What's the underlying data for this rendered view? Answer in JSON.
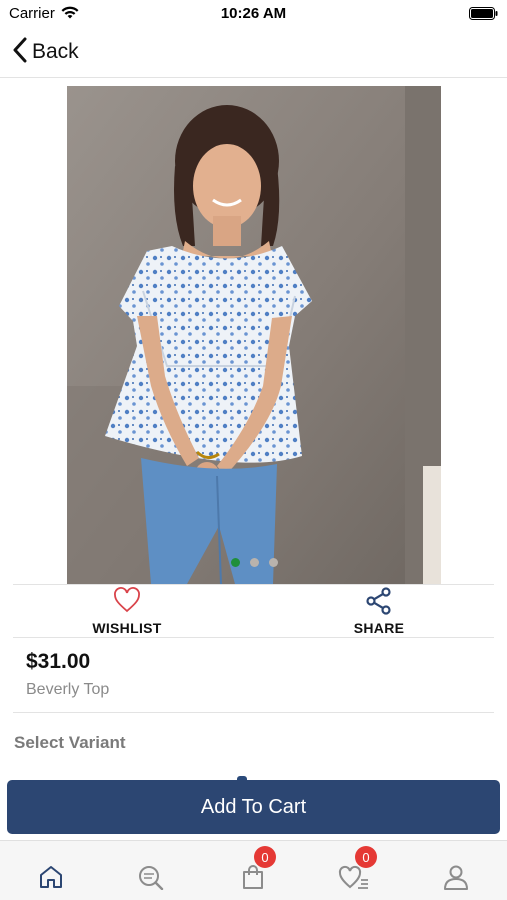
{
  "status_bar": {
    "carrier": "Carrier",
    "time": "10:26 AM"
  },
  "nav": {
    "back_label": "Back"
  },
  "gallery": {
    "image_alt": "Beverly Top product photo",
    "page_count": 3,
    "active_index": 0
  },
  "actions": {
    "wishlist_label": "WISHLIST",
    "share_label": "SHARE"
  },
  "product": {
    "price": "$31.00",
    "name": "Beverly Top"
  },
  "variants": {
    "heading": "Select Variant"
  },
  "cart_button": {
    "label": "Add To Cart"
  },
  "tab_bar": {
    "items": [
      {
        "icon": "home-icon"
      },
      {
        "icon": "search-icon"
      },
      {
        "icon": "shopping-bag-icon",
        "badge": "0"
      },
      {
        "icon": "wishlist-icon",
        "badge": "0"
      },
      {
        "icon": "profile-icon"
      }
    ]
  },
  "colors": {
    "primary": "#2c4672",
    "wishlist_icon": "#d9434a",
    "share_icon": "#2c4672",
    "badge": "#e53935",
    "active_dot": "#1f8f3a"
  }
}
